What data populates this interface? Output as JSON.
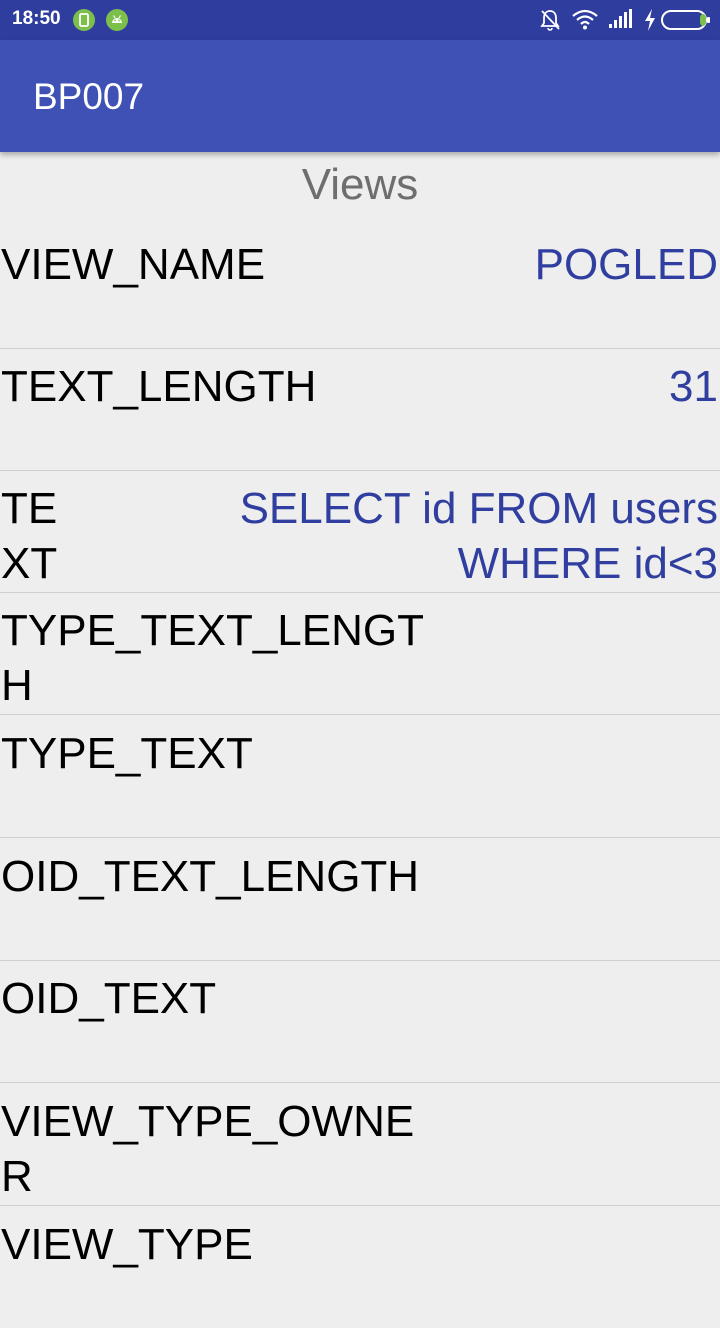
{
  "status_bar": {
    "time": "18:50",
    "notification_icons": [
      "android-notification-icon",
      "android-robot-icon"
    ],
    "system_icons": [
      "mute-bell-icon",
      "wifi-icon",
      "signal-icon",
      "charging-bolt-icon",
      "battery-icon"
    ],
    "background_color": "#2f3d9e"
  },
  "app_bar": {
    "title": "BP007",
    "background_color": "#3f51b5"
  },
  "section": {
    "title": "Views"
  },
  "rows": [
    {
      "key": "VIEW_NAME",
      "value": "POGLED"
    },
    {
      "key": "TEXT_LENGTH",
      "value": "31"
    },
    {
      "key": "TE XT",
      "value": "SELECT id FROM users WHERE id<3"
    },
    {
      "key": "TYPE_TEXT_LENGTH",
      "value": ""
    },
    {
      "key": "TYPE_TEXT",
      "value": ""
    },
    {
      "key": "OID_TEXT_LENGTH",
      "value": ""
    },
    {
      "key": "OID_TEXT",
      "value": ""
    },
    {
      "key": "VIEW_TYPE_OWNER",
      "value": ""
    },
    {
      "key": "VIEW_TYPE",
      "value": ""
    }
  ],
  "colors": {
    "value_text": "#303f9f",
    "key_text": "#000000",
    "background": "#eeeeee"
  }
}
